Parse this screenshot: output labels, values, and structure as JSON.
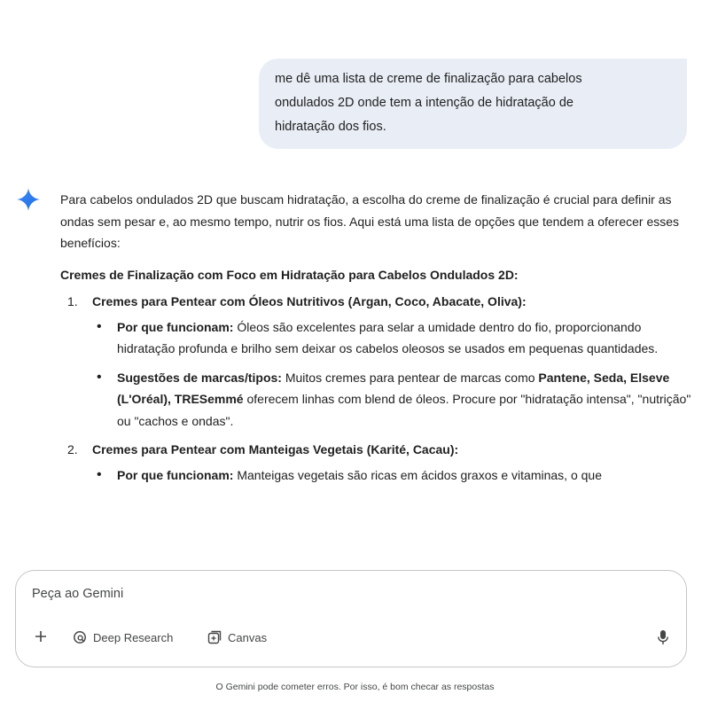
{
  "user_message": {
    "lines": [
      "me dê uma lista de creme de finalização para cabelos",
      "ondulados 2D onde tem a intenção de hidratação de",
      "hidratação dos fios."
    ]
  },
  "response": {
    "intro": "Para cabelos ondulados 2D que buscam hidratação, a escolha do creme de finalização é crucial para definir as ondas sem pesar e, ao mesmo tempo, nutrir os fios. Aqui está uma lista de opções que tendem a oferecer esses benefícios:",
    "heading": "Cremes de Finalização com Foco em Hidratação para Cabelos Ondulados 2D:",
    "items": [
      {
        "number": "1.",
        "title": "Cremes para Pentear com Óleos Nutritivos (Argan, Coco, Abacate, Oliva):",
        "bullets": [
          {
            "label": "Por que funcionam:",
            "text": " Óleos são excelentes para selar a umidade dentro do fio, proporcionando hidratação profunda e brilho sem deixar os cabelos oleosos se usados em pequenas quantidades."
          },
          {
            "label": "Sugestões de marcas/tipos:",
            "text_a": " Muitos cremes para pentear de marcas como ",
            "brands": "Pantene, Seda, Elseve (L'Oréal), TRESemmé",
            "text_b": " oferecem linhas com blend de óleos. Procure por \"hidratação intensa\", \"nutrição\" ou \"cachos e ondas\"."
          }
        ]
      },
      {
        "number": "2.",
        "title": "Cremes para Pentear com Manteigas Vegetais (Karité, Cacau):",
        "bullets": [
          {
            "label": "Por que funcionam:",
            "text": " Manteigas vegetais são ricas em ácidos graxos e vitaminas, o que"
          }
        ]
      }
    ]
  },
  "composer": {
    "placeholder": "Peça ao Gemini",
    "tools": {
      "deep_research": "Deep Research",
      "canvas": "Canvas"
    }
  },
  "icons": {
    "gemini": "gemini-star-icon",
    "add": "plus-icon",
    "deep_research": "deep-research-icon",
    "canvas": "canvas-icon",
    "mic": "microphone-icon"
  },
  "colors": {
    "user_bubble": "#e9eef6",
    "gemini_star": "#4285f4",
    "border": "#c4c7c5"
  },
  "disclaimer": "O Gemini pode cometer erros. Por isso, é bom checar as respostas"
}
